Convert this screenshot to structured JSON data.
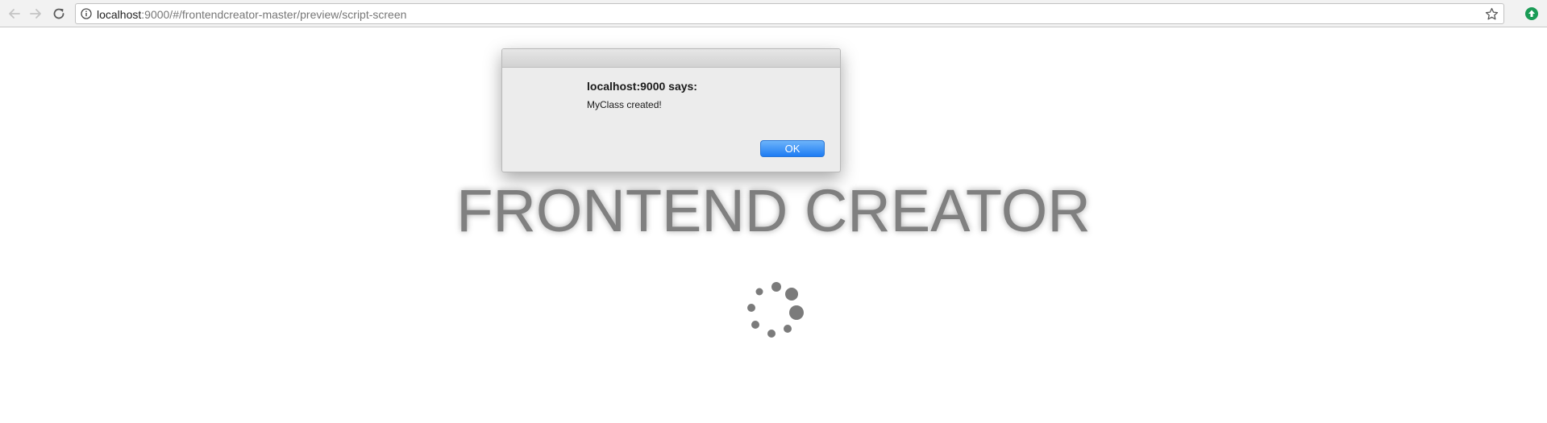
{
  "browser": {
    "url_host": "localhost",
    "url_rest": ":9000/#/frontendcreator-master/preview/script-screen",
    "icons": {
      "back": "arrow-left-icon",
      "forward": "arrow-right-icon",
      "reload": "reload-icon",
      "info": "info-icon",
      "bookmark": "star-icon",
      "extension": "extension-icon"
    },
    "extension_color": "#1a9b55"
  },
  "page": {
    "title": "FRONTEND CREATOR",
    "title_color": "#808080",
    "spinner_color": "#7b7b7b"
  },
  "dialog": {
    "title": "localhost:9000 says:",
    "message": "MyClass created!",
    "ok_label": "OK",
    "ok_color": "#1e7cf3"
  }
}
